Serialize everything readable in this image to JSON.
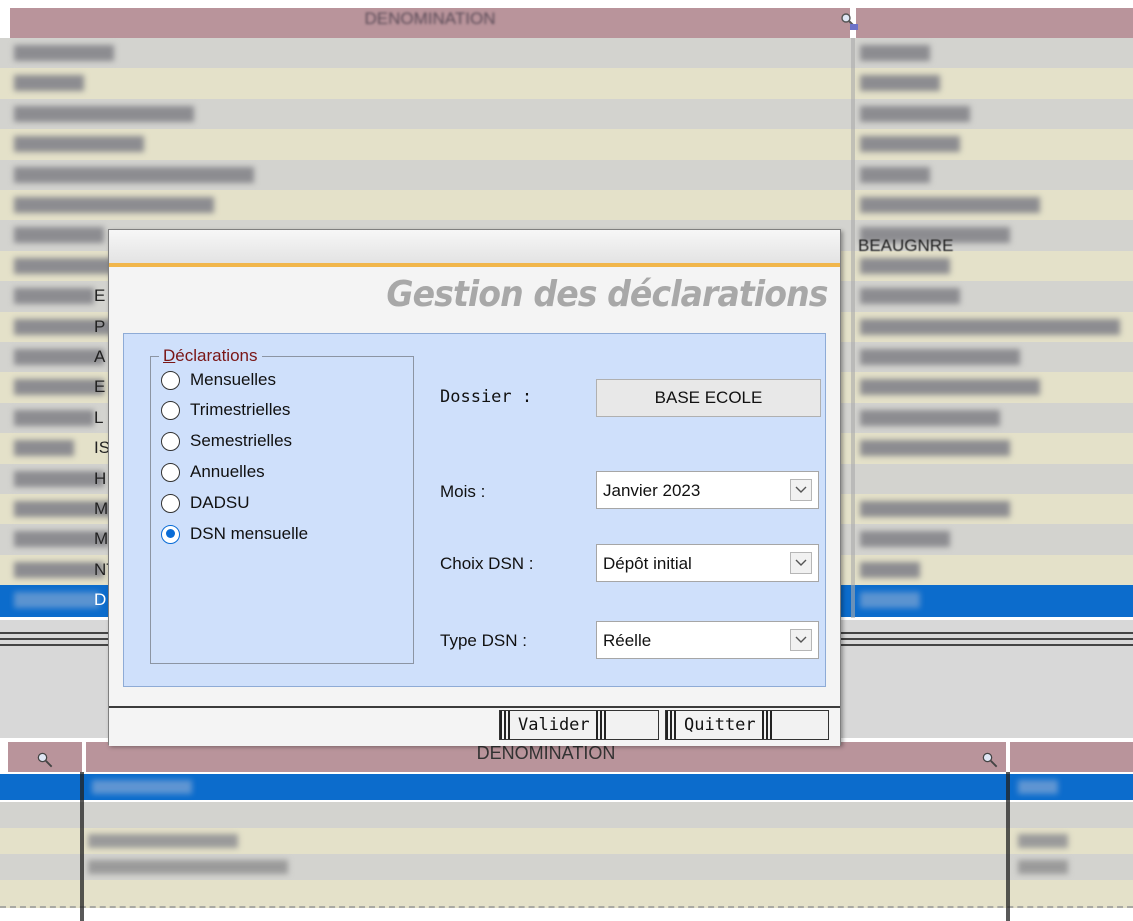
{
  "background_grid": {
    "top_header": "DENOMINATION",
    "right_column_row_text": "BEAUGNRE",
    "left_column_letters": [
      "E",
      "P",
      "A",
      "E",
      "L",
      "IS",
      "H",
      "M",
      "M",
      "NT",
      "D"
    ],
    "bottom_header": "DENOMINATION"
  },
  "dialog": {
    "title": "Gestion des déclarations",
    "group": {
      "legend_prefix": "D",
      "legend_rest": "éclarations",
      "options": [
        {
          "label": "Mensuelles",
          "checked": false
        },
        {
          "label": "Trimestrielles",
          "checked": false
        },
        {
          "label": "Semestrielles",
          "checked": false
        },
        {
          "label": "Annuelles",
          "checked": false
        },
        {
          "label": "DADSU",
          "checked": false
        },
        {
          "label": "DSN mensuelle",
          "checked": true
        }
      ]
    },
    "dossier": {
      "label": "Dossier :",
      "value": "BASE ECOLE"
    },
    "mois": {
      "label": "Mois :",
      "value": "Janvier 2023"
    },
    "choix_dsn": {
      "label": "Choix DSN :",
      "value": "Dépôt initial"
    },
    "type_dsn": {
      "label": "Type DSN :",
      "value": "Réelle"
    },
    "buttons": {
      "validate": "Valider",
      "quit": "Quitter"
    }
  },
  "icons": {
    "header_search": "magnifier-icon",
    "dropdown": "chevron-down-icon"
  }
}
